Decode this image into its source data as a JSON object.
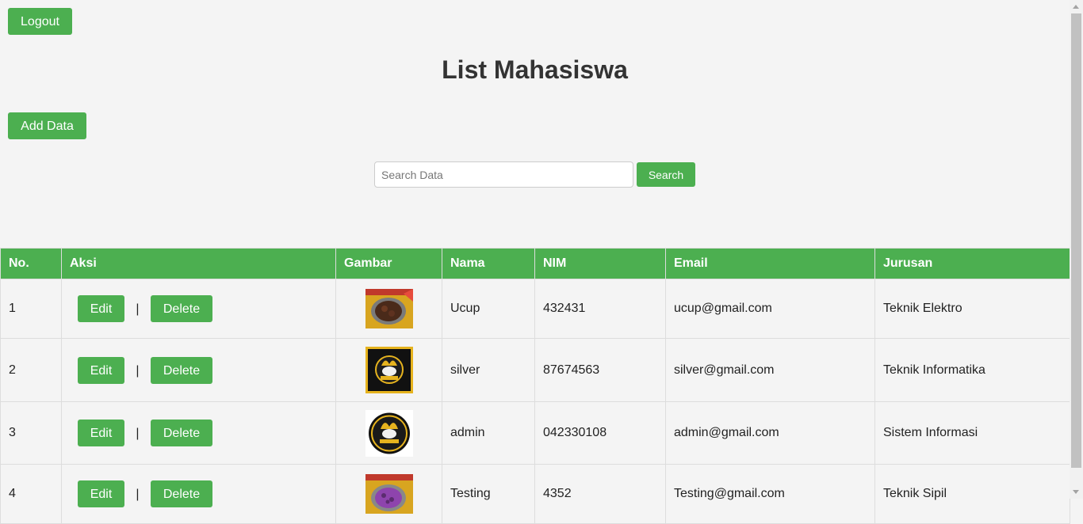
{
  "header": {
    "logout_label": "Logout",
    "title": "List Mahasiswa",
    "add_label": "Add Data"
  },
  "search": {
    "placeholder": "Search Data",
    "value": "",
    "button_label": "Search"
  },
  "table": {
    "columns": [
      "No.",
      "Aksi",
      "Gambar",
      "Nama",
      "NIM",
      "Email",
      "Jurusan"
    ],
    "edit_label": "Edit",
    "delete_label": "Delete",
    "separator": "|",
    "rows": [
      {
        "no": "1",
        "nama": "Ucup",
        "nim": "432431",
        "email": "ucup@gmail.com",
        "jurusan": "Teknik Elektro",
        "image": "food-photo"
      },
      {
        "no": "2",
        "nama": "silver",
        "nim": "87674563",
        "email": "silver@gmail.com",
        "jurusan": "Teknik Informatika",
        "image": "ayam-pancong-logo-black"
      },
      {
        "no": "3",
        "nama": "admin",
        "nim": "042330108",
        "email": "admin@gmail.com",
        "jurusan": "Sistem Informasi",
        "image": "ayam-pancong-logo-round"
      },
      {
        "no": "4",
        "nama": "Testing",
        "nim": "4352",
        "email": "Testing@gmail.com",
        "jurusan": "Teknik Sipil",
        "image": "food-photo-purple"
      }
    ]
  },
  "colors": {
    "accent": "#4caf50",
    "background": "#f4f4f4"
  }
}
